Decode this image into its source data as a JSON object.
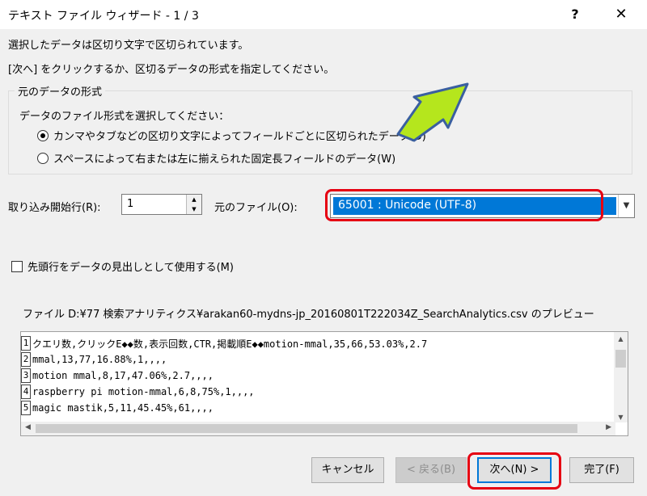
{
  "window": {
    "title": "テキスト ファイル ウィザード - 1 / 3",
    "help": "?",
    "close": "✕"
  },
  "intro": {
    "line1": "選択したデータは区切り文字で区切られています。",
    "line2": "[次へ] をクリックするか、区切るデータの形式を指定してください。"
  },
  "format_group": {
    "title": "元のデータの形式",
    "subtitle": "データのファイル形式を選択してください：",
    "options": [
      {
        "label": "カンマやタブなどの区切り文字によってフィールドごとに区切られたデータ(D)",
        "selected": true
      },
      {
        "label": "スペースによって右または左に揃えられた固定長フィールドのデータ(W)",
        "selected": false
      }
    ]
  },
  "start_row": {
    "label": "取り込み開始行(R):",
    "value": "1"
  },
  "origin": {
    "label": "元のファイル(O):",
    "value": "65001 : Unicode (UTF-8)"
  },
  "header_checkbox": {
    "label": "先頭行をデータの見出しとして使用する(M)",
    "checked": false
  },
  "preview": {
    "label": "ファイル D:¥77 検索アナリティクス¥arakan60-mydns-jp_20160801T222034Z_SearchAnalytics.csv のプレビュー",
    "rows": [
      {
        "num": "1",
        "text": "クエリ数,クリックE◆◆数,表示回数,CTR,掲載順E◆◆motion-mmal,35,66,53.03%,2.7"
      },
      {
        "num": "2",
        "text": "mmal,13,77,16.88%,1,,,,"
      },
      {
        "num": "3",
        "text": "motion mmal,8,17,47.06%,2.7,,,,"
      },
      {
        "num": "4",
        "text": "raspberry pi motion-mmal,6,8,75%,1,,,,"
      },
      {
        "num": "5",
        "text": "magic mastik,5,11,45.45%,61,,,,"
      }
    ]
  },
  "buttons": {
    "cancel": "キャンセル",
    "back": "< 戻る(B)",
    "next": "次へ(N) >",
    "finish": "完了(F)"
  },
  "colors": {
    "highlight": "#e60012",
    "selection": "#0078d7",
    "arrow": "#b5e61d"
  }
}
